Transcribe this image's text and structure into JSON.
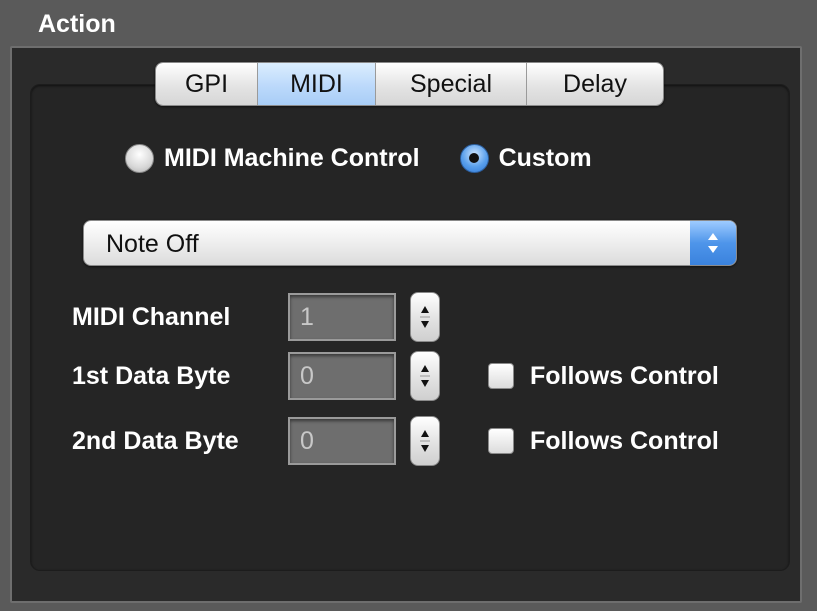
{
  "panel": {
    "title": "Action"
  },
  "tabs": [
    {
      "label": "GPI",
      "selected": false
    },
    {
      "label": "MIDI",
      "selected": true
    },
    {
      "label": "Special",
      "selected": false
    },
    {
      "label": "Delay",
      "selected": false
    }
  ],
  "mode": {
    "options": [
      {
        "label": "MIDI Machine Control",
        "checked": false
      },
      {
        "label": "Custom",
        "checked": true
      }
    ]
  },
  "message_type": {
    "selected": "Note Off",
    "icon": "up-down-arrows-icon"
  },
  "fields": {
    "midi_channel": {
      "label": "MIDI Channel",
      "value": "1"
    },
    "data_byte_1": {
      "label": "1st Data Byte",
      "value": "0",
      "follows_label": "Follows Control",
      "follows_checked": false
    },
    "data_byte_2": {
      "label": "2nd Data Byte",
      "value": "0",
      "follows_label": "Follows Control",
      "follows_checked": false
    }
  },
  "colors": {
    "background": "#5a5a5a",
    "panel": "#2a2a2a",
    "accent_blue": "#3a82dd",
    "tab_selected": "#bcd9fb"
  }
}
